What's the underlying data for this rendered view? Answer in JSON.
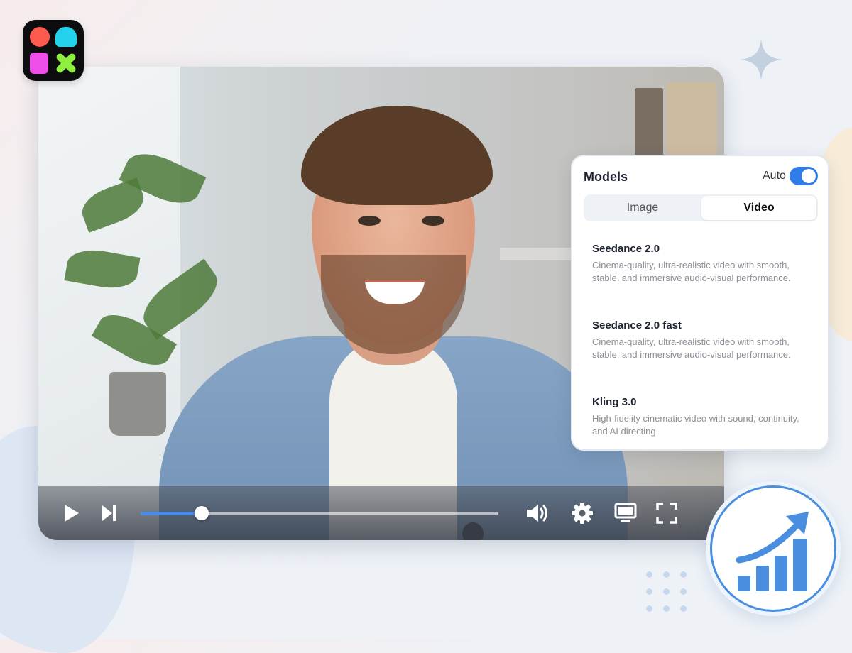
{
  "colors": {
    "accent": "#2f7de8",
    "progress": "#4a8be6",
    "badge_ring": "#4a8ee0",
    "logo_bg": "#0d0d0f"
  },
  "icons": {
    "logo": "app-logo-icon",
    "sparkle": "sparkle-icon",
    "play": "play-icon",
    "next": "skip-next-icon",
    "volume": "volume-icon",
    "settings": "gear-icon",
    "theater": "monitor-icon",
    "fullscreen": "fullscreen-icon",
    "growth": "growth-chart-icon"
  },
  "player": {
    "progress_fraction": 0.17
  },
  "models_panel": {
    "title": "Models",
    "auto_label": "Auto",
    "auto_enabled": true,
    "tabs": [
      {
        "label": "Image",
        "active": false
      },
      {
        "label": "Video",
        "active": true
      }
    ],
    "items": [
      {
        "name": "Seedance 2.0",
        "description": "Cinema-quality, ultra-realistic video with smooth, stable, and immersive audio-visual performance."
      },
      {
        "name": "Seedance 2.0 fast",
        "description": "Cinema-quality, ultra-realistic video with smooth, stable, and immersive audio-visual performance."
      },
      {
        "name": "Kling 3.0",
        "description": "High-fidelity cinematic video with sound, continuity, and AI directing."
      }
    ]
  }
}
